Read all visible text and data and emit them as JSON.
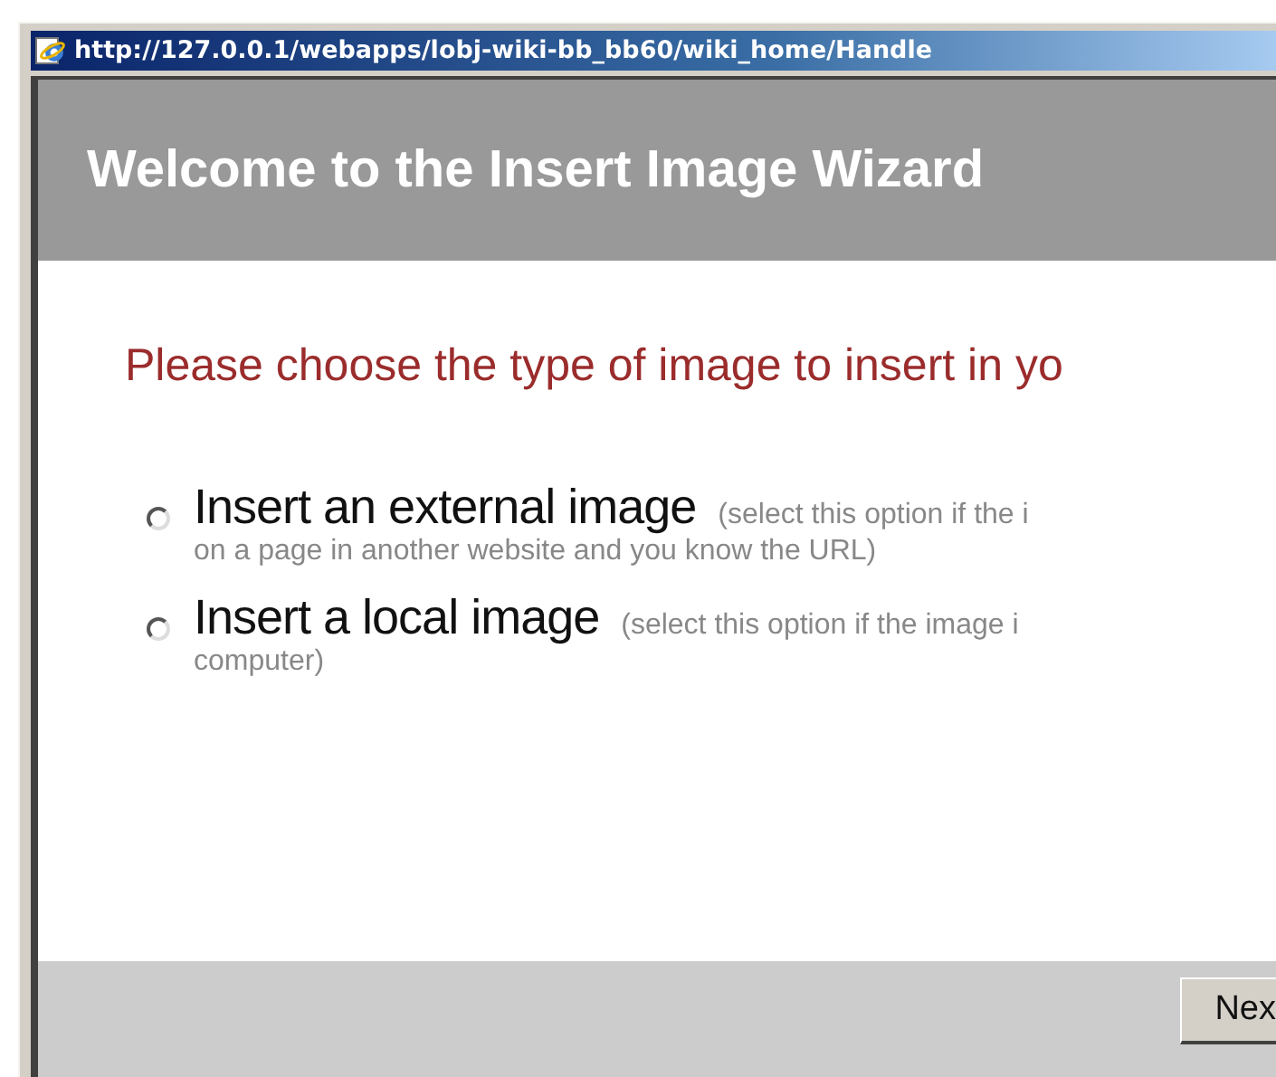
{
  "window": {
    "title": "http://127.0.0.1/webapps/lobj-wiki-bb_bb60/wiki_home/Handle"
  },
  "header": {
    "title": "Welcome to the Insert Image Wizard"
  },
  "question": "Please choose the type of image to insert in yo",
  "options": [
    {
      "label": "Insert an external image",
      "hint": "(select this option if the i",
      "hint_continued": "on a page in another website and you know the URL)",
      "selected": false
    },
    {
      "label": "Insert a local image",
      "hint": "(select this option if the image i",
      "hint_continued": "computer)",
      "selected": false
    }
  ],
  "buttons": [
    "Nex"
  ]
}
